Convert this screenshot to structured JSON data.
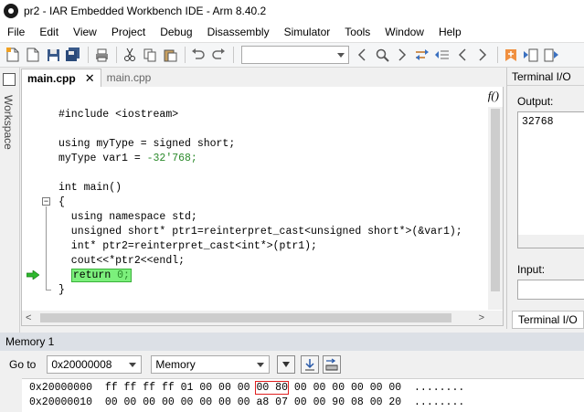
{
  "window": {
    "title": "pr2 - IAR Embedded Workbench IDE - Arm 8.40.2"
  },
  "menu": [
    "File",
    "Edit",
    "View",
    "Project",
    "Debug",
    "Disassembly",
    "Simulator",
    "Tools",
    "Window",
    "Help"
  ],
  "workspace": {
    "label": "Workspace"
  },
  "editor": {
    "tabs": [
      {
        "label": "main.cpp",
        "active": true,
        "close": "✕"
      },
      {
        "label": "main.cpp",
        "active": false
      }
    ],
    "fn_label": "f()",
    "code": [
      "#include <iostream>",
      "",
      "using myType = signed short;",
      "myType var1 = ",
      "",
      "int main()",
      "{",
      "  using namespace std;",
      "  unsigned short* ptr1=reinterpret_cast<unsigned short*>(&var1);",
      "  int* ptr2=reinterpret_cast<int*>(ptr1);",
      "  cout<<*ptr2<<endl;",
      "  ",
      "}"
    ],
    "var_value": "-32'768;",
    "return_kw": "return ",
    "return_val": "0;"
  },
  "terminal": {
    "title": "Terminal I/O",
    "output_label": "Output:",
    "output_text": "32768",
    "input_label": "Input:",
    "tab_label": "Terminal I/O"
  },
  "memory": {
    "title": "Memory 1",
    "goto_label": "Go to",
    "goto_value": "0x20000008",
    "zone": "Memory",
    "rows": [
      {
        "addr": "0x20000000",
        "pre": "ff ff ff ff 01 00 00 00",
        "hl": "00 80",
        "post": "00 00 00 00 00 00",
        "ascii": "........"
      },
      {
        "addr": "0x20000010",
        "pre": "00 00 00 00 00 00 00 00",
        "hl": "a8 07",
        "post": "00 00 90 08 00 20",
        "ascii": "........"
      }
    ]
  }
}
